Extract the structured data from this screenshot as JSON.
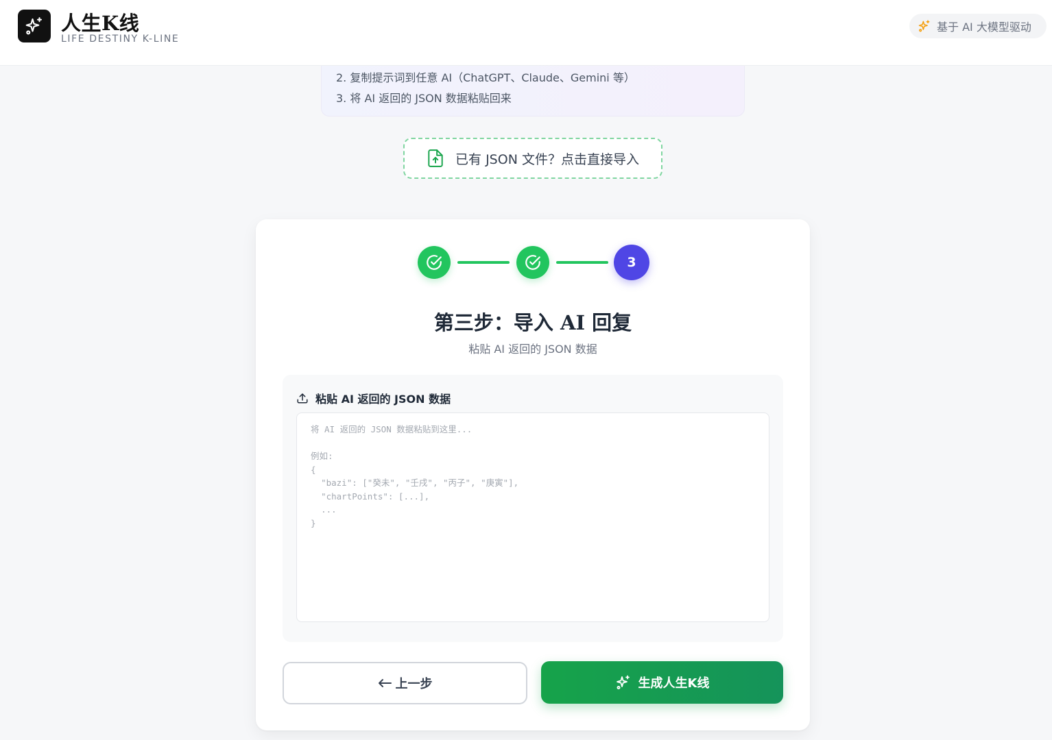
{
  "header": {
    "title": "人生K线",
    "subtitle": "LIFE DESTINY K-LINE",
    "badge": "基于 AI 大模型驱动",
    "logo_icon": "sparkles-icon",
    "badge_icon": "sparkles-icon"
  },
  "instructions": {
    "lines": [
      "2. 复制提示词到任意 AI（ChatGPT、Claude、Gemini 等）",
      "3. 将 AI 返回的 JSON 数据粘贴回来"
    ]
  },
  "import": {
    "label": "已有 JSON 文件？点击直接导入",
    "icon": "file-upload-icon"
  },
  "stepper": {
    "steps": [
      {
        "state": "done",
        "icon": "check-circle-icon"
      },
      {
        "state": "done",
        "icon": "check-circle-icon"
      },
      {
        "state": "current",
        "label": "3"
      }
    ]
  },
  "step": {
    "title": "第三步：导入 AI 回复",
    "subtitle": "粘贴 AI 返回的 JSON 数据"
  },
  "paste": {
    "label": "粘贴 AI 返回的 JSON 数据",
    "icon": "upload-icon",
    "value": "",
    "placeholder": "将 AI 返回的 JSON 数据粘贴到这里...\n\n例如:\n{\n  \"bazi\": [\"癸未\", \"壬戌\", \"丙子\", \"庚寅\"],\n  \"chartPoints\": [...],\n  ...\n}"
  },
  "buttons": {
    "prev_label": "上一步",
    "prev_icon": "arrow-left-icon",
    "generate_label": "生成人生K线",
    "generate_icon": "sparkles-icon"
  },
  "colors": {
    "accent_green": "#22c55e",
    "accent_indigo": "#4f46e5",
    "generate_button": "#16a34a"
  }
}
